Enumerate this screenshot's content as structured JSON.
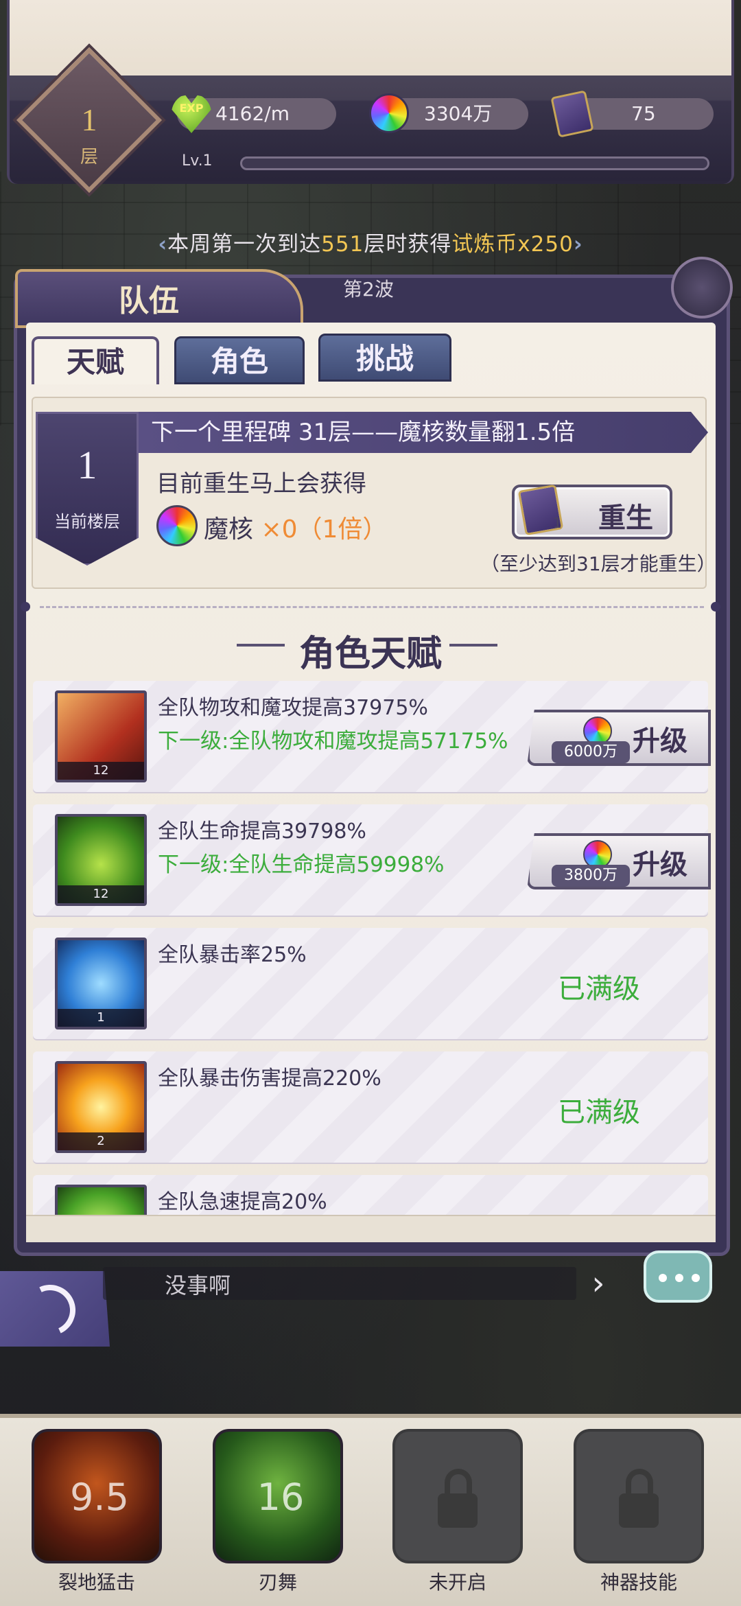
{
  "top_status": {
    "floor_number": "1",
    "floor_unit": "层",
    "exp_badge": "EXP",
    "exp_rate": "4162/m",
    "magic_core_amount": "3304万",
    "book_count": "75",
    "level_label": "Lv.1",
    "level_progress": 0
  },
  "weekly_notice": {
    "prefix": "本周第一次到达",
    "floor": "551",
    "middle": "层时获得",
    "reward": "试炼币x250"
  },
  "team_panel": {
    "title": "队伍",
    "wave_label": "第2波",
    "tabs": [
      {
        "label": "天赋",
        "active": true
      },
      {
        "label": "角色",
        "active": false
      },
      {
        "label": "挑战",
        "active": false
      }
    ]
  },
  "milestone": {
    "text": "下一个里程碑 31层——魔核数量翻1.5倍",
    "current_floor": "1",
    "current_floor_label": "当前楼层",
    "rebirth_gain_title": "目前重生马上会获得",
    "core_name": "魔核",
    "core_amount": " ×0（1倍）",
    "rebirth_button": "重生",
    "rebirth_book_count": "1",
    "rebirth_requirement": "（至少达到31层才能重生）"
  },
  "talent_section": {
    "title": "角色天赋",
    "items": [
      {
        "icon": "sword-icon",
        "level": "12",
        "desc": "全队物攻和魔攻提高37975%",
        "next": "下一级:全队物攻和魔攻提高57175%",
        "cost": "6000万",
        "button": "升级",
        "maxed": ""
      },
      {
        "icon": "winged-egg-icon",
        "level": "12",
        "desc": "全队生命提高39798%",
        "next": "下一级:全队生命提高59998%",
        "cost": "3800万",
        "button": "升级",
        "maxed": ""
      },
      {
        "icon": "hexagram-orb-icon",
        "level": "1",
        "desc": "全队暴击率25%",
        "next": "",
        "cost": "",
        "button": "",
        "maxed": "已满级"
      },
      {
        "icon": "critical-burst-icon",
        "level": "2",
        "desc": "全队暴击伤害提高220%",
        "next": "",
        "cost": "",
        "button": "",
        "maxed": "已满级"
      },
      {
        "icon": "haste-icon",
        "level": "",
        "desc": "全队急速提高20%",
        "next": "",
        "cost": "",
        "button": "",
        "maxed": ""
      }
    ]
  },
  "chat": {
    "message": "没事啊"
  },
  "skills": [
    {
      "name": "裂地猛击",
      "cooldown": "9.5",
      "locked": false
    },
    {
      "name": "刃舞",
      "cooldown": "16",
      "locked": false
    },
    {
      "name": "未开启",
      "cooldown": "",
      "locked": true
    },
    {
      "name": "神器技能",
      "cooldown": "",
      "locked": true
    }
  ],
  "colors": {
    "panel_purple": "#3a3456",
    "accent_gold": "#f2c653",
    "green_text": "#3cad3c",
    "orange_text": "#ef8b35"
  }
}
